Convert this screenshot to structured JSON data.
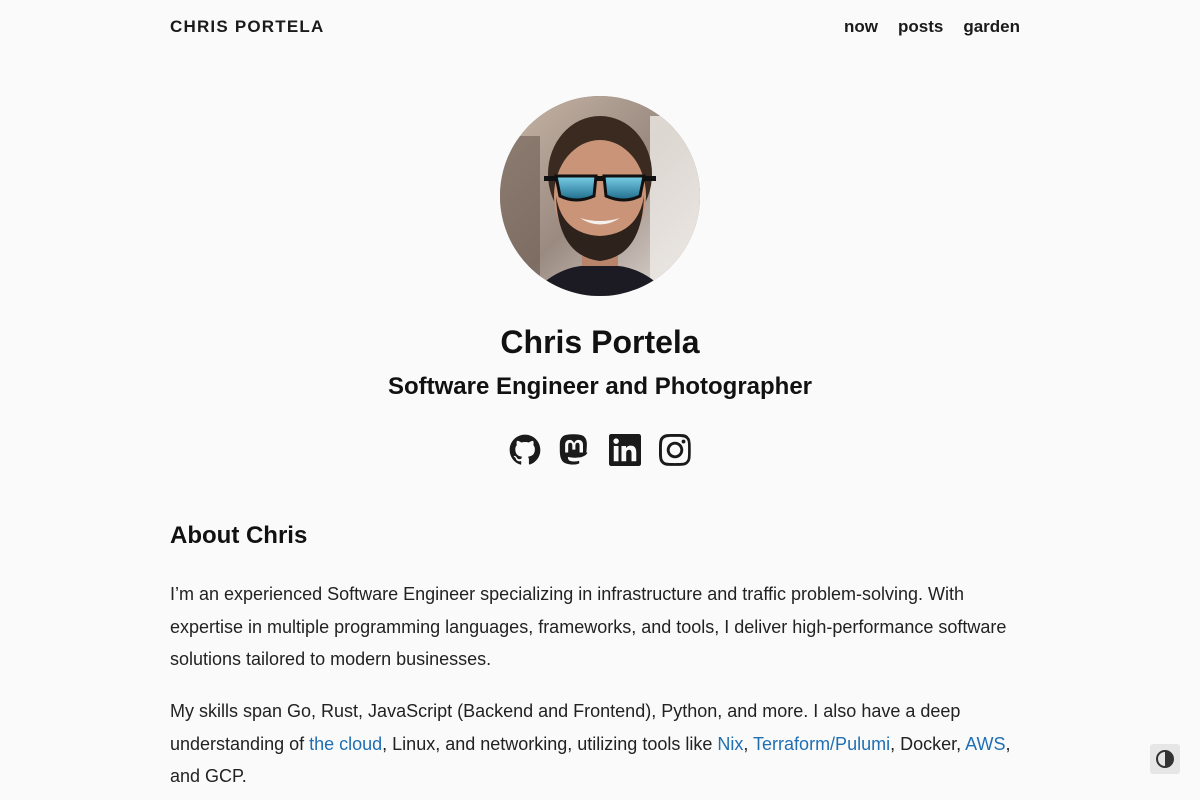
{
  "header": {
    "site_title": "CHRIS PORTELA",
    "nav": [
      {
        "label": "now"
      },
      {
        "label": "posts"
      },
      {
        "label": "garden"
      }
    ]
  },
  "hero": {
    "name": "Chris Portela",
    "subtitle": "Software Engineer and Photographer",
    "socials": [
      {
        "icon": "github-icon"
      },
      {
        "icon": "mastodon-icon"
      },
      {
        "icon": "linkedin-icon"
      },
      {
        "icon": "instagram-icon"
      }
    ]
  },
  "about": {
    "heading": "About Chris",
    "p1": "I’m an experienced Software Engineer specializing in infrastructure and traffic problem-solving. With expertise in multiple programming languages, frameworks, and tools, I deliver high-performance software solutions tailored to modern businesses.",
    "p2": {
      "t1": "My skills span Go, Rust, JavaScript (Backend and Frontend), Python, and more. I also have a deep understanding of ",
      "link_cloud": "the cloud",
      "t2": ", Linux, and networking, utilizing tools like ",
      "link_nix": "Nix",
      "t3": ", ",
      "link_terraform": "Terraform/Pulumi",
      "t4": ", Docker, ",
      "link_aws": "AWS",
      "t5": ", and GCP."
    }
  },
  "theme_toggle": {
    "icon": "contrast-icon"
  },
  "colors": {
    "background": "#fafafa",
    "text": "#1a1a1a",
    "link": "#1f6fb2"
  }
}
